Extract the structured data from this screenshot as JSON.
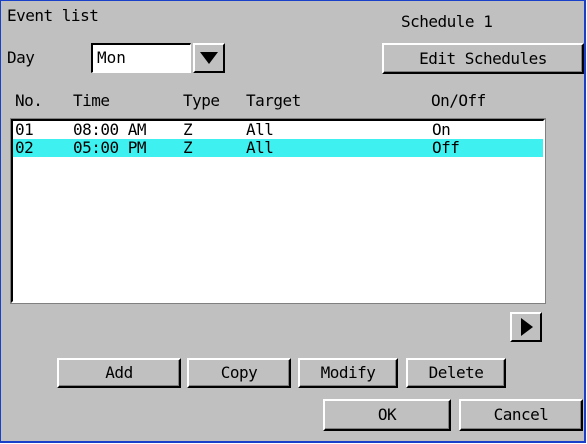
{
  "header": {
    "title": "Event list",
    "schedule_label": "Schedule 1",
    "day_label": "Day",
    "day_value": "Mon",
    "edit_schedules_label": "Edit Schedules"
  },
  "columns": {
    "no": "No.",
    "time": "Time",
    "type": "Type",
    "target": "Target",
    "onoff": "On/Off"
  },
  "events": [
    {
      "no": "01",
      "time": "08:00 AM",
      "type": "Z",
      "target": "All",
      "onoff": "On",
      "selected": false
    },
    {
      "no": "02",
      "time": "05:00 PM",
      "type": "Z",
      "target": "All",
      "onoff": "Off",
      "selected": true
    }
  ],
  "buttons": {
    "add": "Add",
    "copy": "Copy",
    "modify": "Modify",
    "delete": "Delete",
    "ok": "OK",
    "cancel": "Cancel"
  },
  "icons": {
    "dropdown": "triangle-down-icon",
    "scroll": "triangle-right-icon"
  },
  "colors": {
    "panel": "#c0c0c0",
    "selection": "#3ff0f0",
    "frame": "#1840c8"
  }
}
